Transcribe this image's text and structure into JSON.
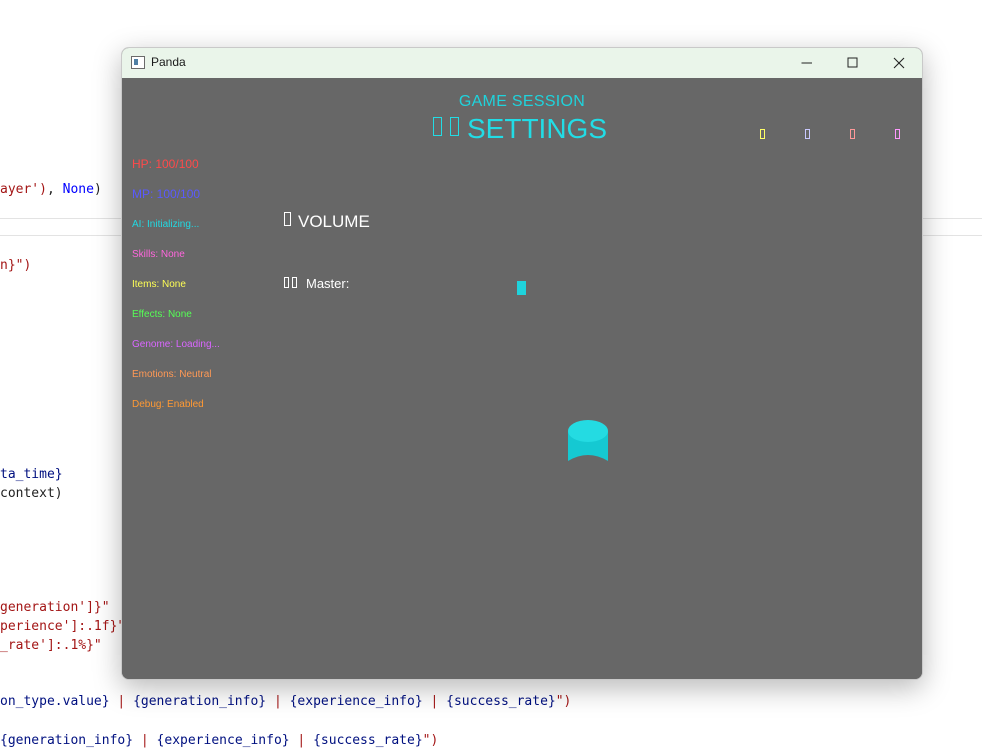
{
  "background_editor": {
    "lines": [
      {
        "parts": [
          {
            "t": "ayer')",
            "c": "str"
          },
          {
            "t": ", ",
            "c": ""
          },
          {
            "t": "None",
            "c": "kw"
          },
          {
            "t": ")",
            "c": ""
          }
        ]
      },
      {
        "parts": [
          {
            "t": "n}\")",
            "c": "str"
          }
        ]
      },
      {
        "parts": [
          {
            "t": "ta_time}",
            "c": "var"
          }
        ]
      },
      {
        "parts": [
          {
            "t": "context)",
            "c": ""
          }
        ]
      },
      {
        "parts": [
          {
            "t": "generation']}\"",
            "c": "str"
          }
        ]
      },
      {
        "parts": [
          {
            "t": "perience']:.1f}\"",
            "c": "str"
          }
        ]
      },
      {
        "parts": [
          {
            "t": "_rate']:.1%}\"",
            "c": "str"
          }
        ]
      },
      {
        "parts": [
          {
            "t": "on_type.value}",
            "c": "var"
          },
          {
            "t": " | ",
            "c": "pipe"
          },
          {
            "t": "{generation_info}",
            "c": "var"
          },
          {
            "t": " | ",
            "c": "pipe"
          },
          {
            "t": "{experience_info}",
            "c": "var"
          },
          {
            "t": " | ",
            "c": "pipe"
          },
          {
            "t": "{success_rate}",
            "c": "var"
          },
          {
            "t": "\")",
            "c": "str"
          }
        ]
      },
      {
        "parts": [
          {
            "t": "{generation_info}",
            "c": "var"
          },
          {
            "t": " | ",
            "c": "pipe"
          },
          {
            "t": "{experience_info}",
            "c": "var"
          },
          {
            "t": " | ",
            "c": "pipe"
          },
          {
            "t": "{success_rate}",
            "c": "var"
          },
          {
            "t": "\")",
            "c": "str"
          }
        ]
      }
    ]
  },
  "window": {
    "title": "Panda",
    "controls": {
      "minimize": "minimize-icon",
      "maximize": "maximize-icon",
      "close": "close-icon"
    }
  },
  "game": {
    "subtitle": "GAME SESSION",
    "title": "SETTINGS",
    "indicator_colors": [
      "#ffff66",
      "#c9c9ff",
      "#ff9999",
      "#ff99ff"
    ],
    "stats": [
      {
        "text": "HP: 100/100",
        "color": "#ff4a4a"
      },
      {
        "text": "MP: 100/100",
        "color": "#5a5aff"
      },
      {
        "text": "AI: Initializing...",
        "color": "#21d9e2"
      },
      {
        "text": "Skills: None",
        "color": "#ff66dd"
      },
      {
        "text": "Items: None",
        "color": "#ffff55"
      },
      {
        "text": "Effects: None",
        "color": "#55ff55"
      },
      {
        "text": "Genome: Loading...",
        "color": "#d966ff"
      },
      {
        "text": "Emotions: Neutral",
        "color": "#ff9955"
      },
      {
        "text": "Debug: Enabled",
        "color": "#ff9933"
      }
    ],
    "volume": {
      "heading": "VOLUME",
      "master_label": "Master:",
      "slider_color": "#1fd3dc"
    },
    "accent": "#22dce5",
    "background": "#676767"
  }
}
